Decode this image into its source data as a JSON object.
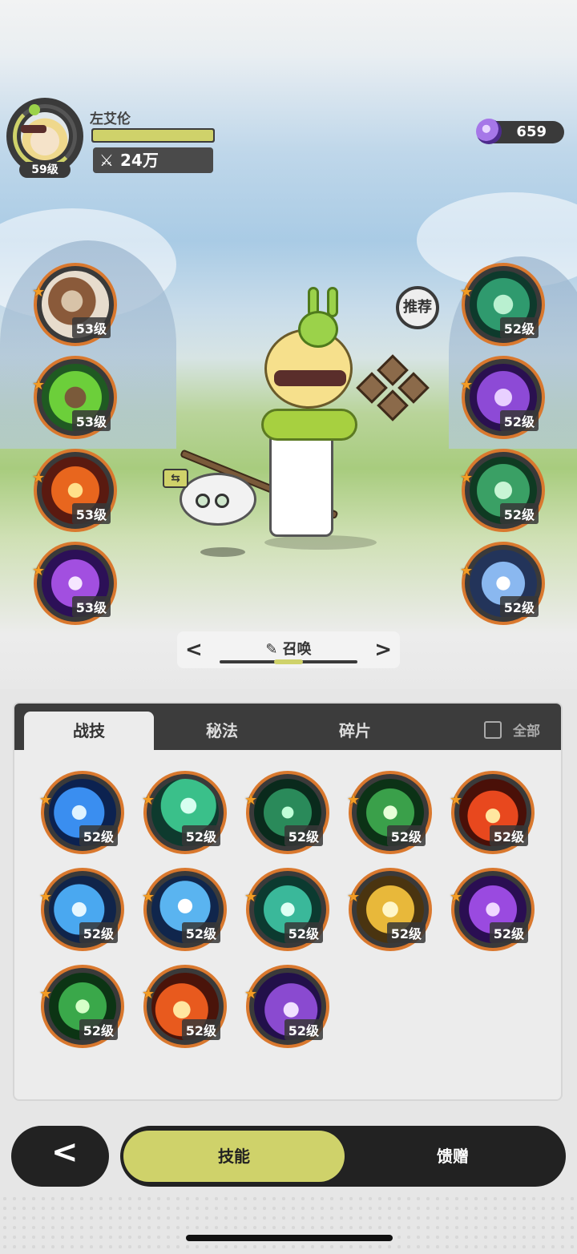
{
  "header": {
    "player_name": "左艾伦",
    "level": "59级",
    "power": "24万",
    "hp_fraction": 1.0,
    "gems": "659"
  },
  "recommend_label": "推荐",
  "left_slots": [
    {
      "level": "53级",
      "art": "rock"
    },
    {
      "level": "53级",
      "art": "nature"
    },
    {
      "level": "53级",
      "art": "fire"
    },
    {
      "level": "53级",
      "art": "arcane"
    }
  ],
  "right_slots": [
    {
      "level": "52级",
      "art": "shield"
    },
    {
      "level": "52级",
      "art": "void-fist"
    },
    {
      "level": "52级",
      "art": "jade-fist"
    },
    {
      "level": "52级",
      "art": "frost-star"
    }
  ],
  "summon_selector": {
    "label": "召唤",
    "prev": "<",
    "next": ">"
  },
  "panel": {
    "tabs": [
      "战技",
      "秘法",
      "碎片"
    ],
    "active_tab": 0,
    "select_all_label": "全部",
    "skills": [
      {
        "level": "52级",
        "art": "water"
      },
      {
        "level": "52级",
        "art": "wind"
      },
      {
        "level": "52级",
        "art": "thorn"
      },
      {
        "level": "52级",
        "art": "heal"
      },
      {
        "level": "52级",
        "art": "flame"
      },
      {
        "level": "52级",
        "art": "ice-shard"
      },
      {
        "level": "52级",
        "art": "frost-burst"
      },
      {
        "level": "52级",
        "art": "vortex"
      },
      {
        "level": "52级",
        "art": "holy"
      },
      {
        "level": "52级",
        "art": "eye"
      },
      {
        "level": "52级",
        "art": "leaf"
      },
      {
        "level": "52级",
        "art": "fireball"
      },
      {
        "level": "52级",
        "art": "shadow"
      }
    ]
  },
  "bottom_tabs": {
    "skills": "技能",
    "gift": "馈赠",
    "back": "<"
  },
  "colors": {
    "accent": "#cfd26a",
    "dark": "#3a3a3a",
    "frame_orange": "#d9782e",
    "star": "#f39c24"
  }
}
